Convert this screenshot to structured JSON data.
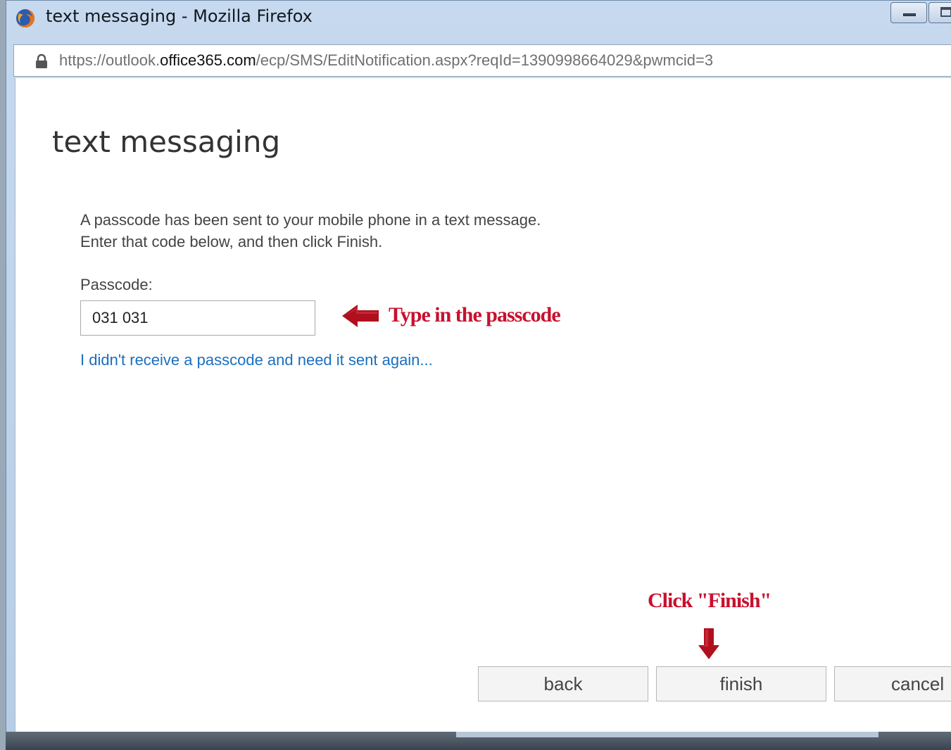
{
  "window": {
    "title": "text messaging - Mozilla Firefox"
  },
  "urlbar": {
    "url_prefix": "https://outlook.",
    "url_host": "office365.com",
    "url_path": "/ecp/SMS/EditNotification.aspx?reqId=1390998664029&pwmcid=3"
  },
  "page": {
    "title": "text messaging",
    "instructions": "A passcode has been sent to your mobile phone in a text message. Enter that code below, and then click Finish.",
    "passcode_label": "Passcode:",
    "passcode_value": "031 031",
    "resend_link": "I didn't receive a passcode and need it sent again..."
  },
  "annotations": {
    "passcode_note": "Type in the passcode",
    "finish_note": "Click \"Finish\"",
    "color": "#c8102e"
  },
  "buttons": {
    "back": "back",
    "finish": "finish",
    "cancel": "cancel"
  },
  "icons": {
    "browser": "firefox-icon",
    "lock": "lock-icon"
  }
}
